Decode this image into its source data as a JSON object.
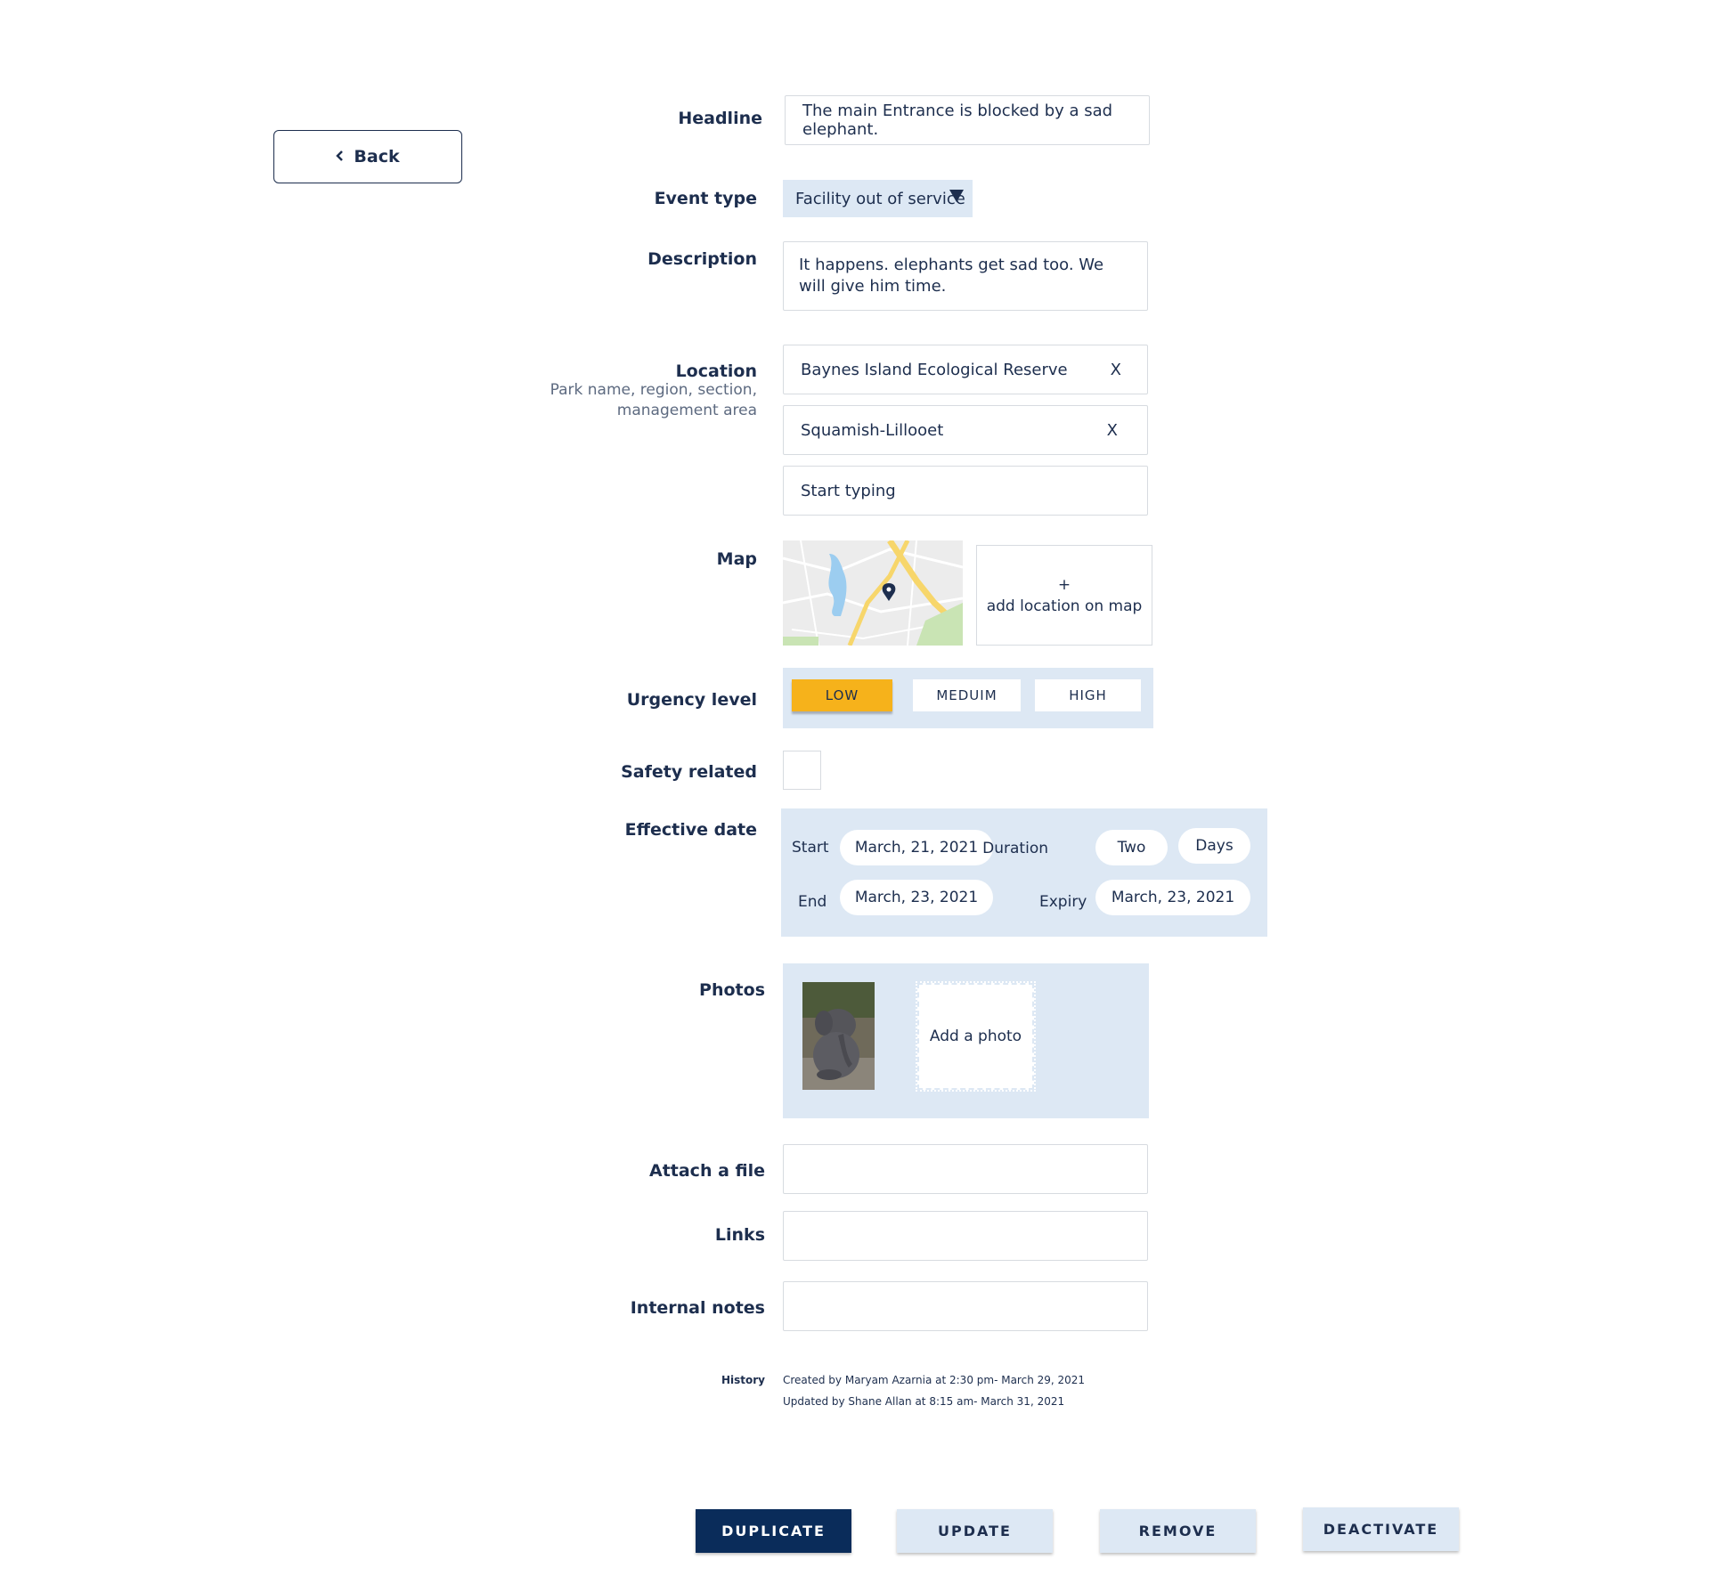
{
  "back": {
    "label": "Back"
  },
  "headline": {
    "label": "Headline",
    "value": "The main Entrance is blocked by a sad elephant."
  },
  "event_type": {
    "label": "Event type",
    "value": "Facility out of service"
  },
  "description": {
    "label": "Description",
    "value": "It happens. elephants get sad too.  We will give him time."
  },
  "location": {
    "label": "Location",
    "hint": "Park name, region, section, management area",
    "tags": [
      "Baynes Island Ecological Reserve",
      "Squamish-Lillooet"
    ],
    "remove_label": "X",
    "placeholder": "Start typing"
  },
  "map": {
    "label": "Map",
    "add_plus": "+",
    "add_label": "add location on map"
  },
  "urgency": {
    "label": "Urgency level",
    "options": [
      "LOW",
      "MEDUIM",
      "HIGH"
    ],
    "selected": "LOW"
  },
  "safety": {
    "label": "Safety related",
    "checked": false
  },
  "effective_date": {
    "label": "Effective date",
    "start_label": "Start",
    "start": "March, 21, 2021",
    "end_label": "End",
    "end": "March, 23, 2021",
    "duration_label": "Duration",
    "duration_value": "Two",
    "duration_unit": "Days",
    "expiry_label": "Expiry",
    "expiry": "March, 23, 2021"
  },
  "photos": {
    "label": "Photos",
    "add_label": "Add a photo"
  },
  "attach": {
    "label": "Attach a file"
  },
  "links": {
    "label": "Links"
  },
  "notes": {
    "label": "Internal notes"
  },
  "history": {
    "label": "History",
    "created": "Created by Maryam Azarnia at 2:30 pm- March 29, 2021",
    "updated": "Updated by Shane Allan at 8:15 am- March 31, 2021"
  },
  "actions": {
    "duplicate": "DUPLICATE",
    "update": "UPDATE",
    "remove": "REMOVE",
    "deactivate": "DEACTIVATE"
  },
  "colors": {
    "navy": "#1d2e4e",
    "primary": "#0a2c5a",
    "panel": "#dde8f4",
    "urgency_active": "#f6b21b"
  }
}
